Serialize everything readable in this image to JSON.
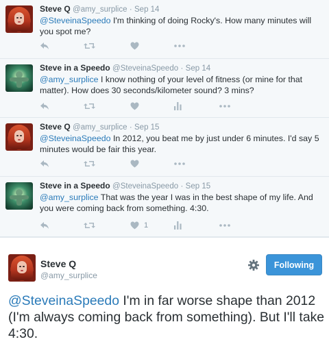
{
  "thread": [
    {
      "name": "Steve Q",
      "handle": "@amy_surplice",
      "sep": "·",
      "date": "Sep 14",
      "mention": "@SteveinaSpeedo",
      "body": " I'm thinking of doing Rocky's. How many minutes will you spot me?",
      "avatar_icon": "red-hair-avatar-icon"
    },
    {
      "name": "Steve in a Speedo",
      "handle": "@SteveinaSpeedo",
      "sep": "·",
      "date": "Sep 14",
      "mention": "@amy_surplice",
      "body": " I know nothing of your level of fitness (or mine for that matter). How does 30 seconds/kilometer sound?  3 mins?",
      "avatar_icon": "swimmer-avatar-icon"
    },
    {
      "name": "Steve Q",
      "handle": "@amy_surplice",
      "sep": "·",
      "date": "Sep 15",
      "mention": "@SteveinaSpeedo",
      "body": " In 2012, you beat me by just under 6 minutes. I'd say 5 minutes would be fair this year.",
      "avatar_icon": "red-hair-avatar-icon"
    },
    {
      "name": "Steve in a Speedo",
      "handle": "@SteveinaSpeedo",
      "sep": "·",
      "date": "Sep 15",
      "mention": "@amy_surplice",
      "body": " That was the year I was in the best shape of my life.  And you were coming back from something.  4:30.",
      "favorite_count": "1",
      "avatar_icon": "swimmer-avatar-icon"
    }
  ],
  "main_tweet": {
    "name": "Steve Q",
    "handle": "@amy_surplice",
    "follow_label": "Following",
    "mention": "@SteveinaSpeedo",
    "body": " I'm in far worse shape than 2012 (I'm always coming back from something). But I'll take 4:30."
  },
  "colors": {
    "link": "#2b7bb9",
    "follow_button": "#3b94d9",
    "action_icon": "#aab8c2",
    "thread_bg": "#f5f8fa"
  },
  "icons": [
    "reply-icon",
    "retweet-icon",
    "favorite-icon",
    "stats-icon",
    "more-icon",
    "gear-icon"
  ]
}
